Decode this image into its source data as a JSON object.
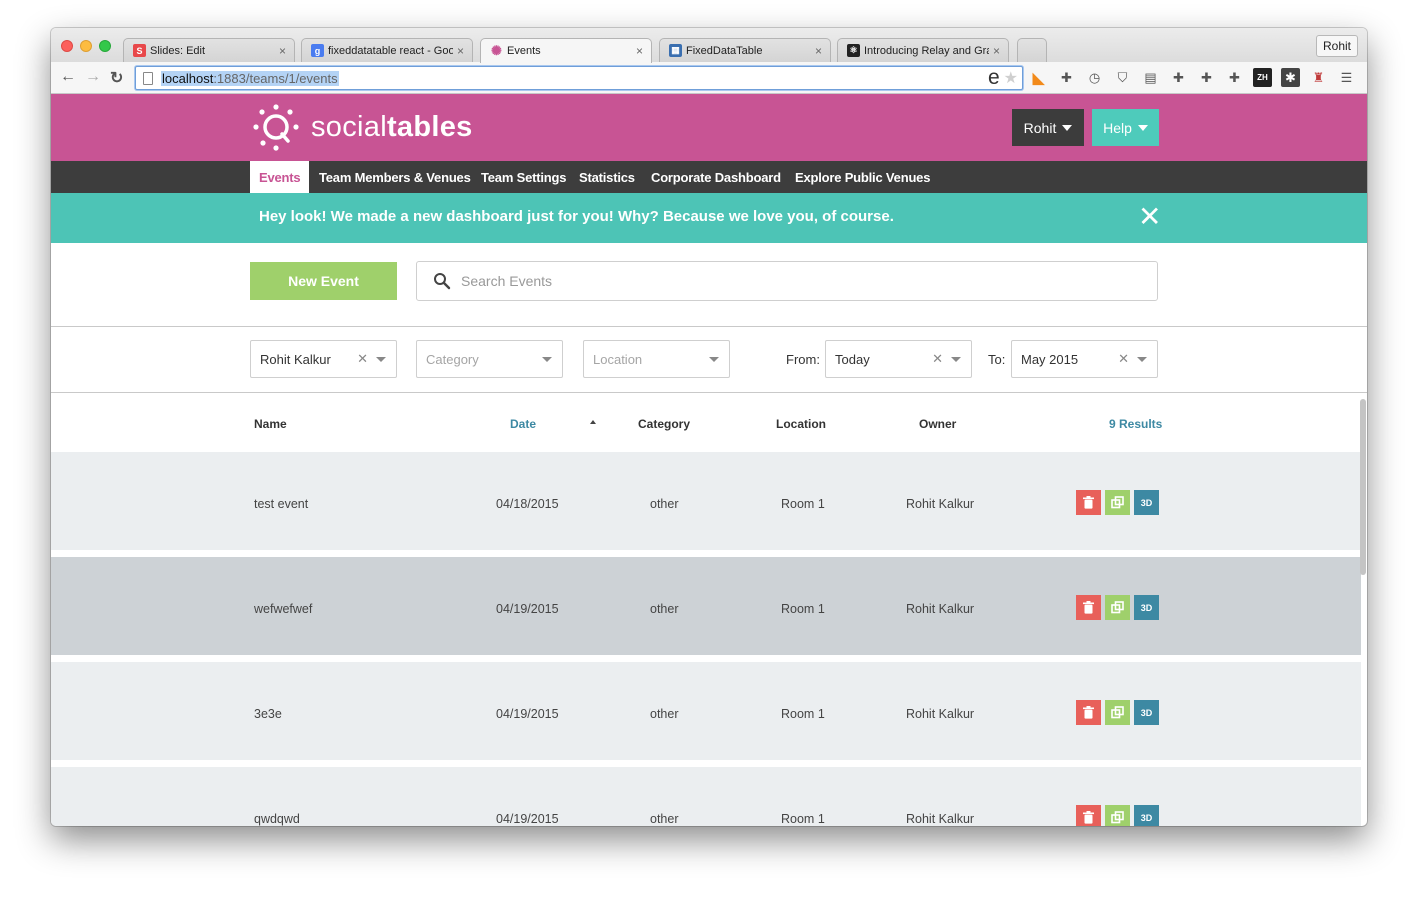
{
  "browser": {
    "tabs": [
      {
        "title": "Slides: Edit",
        "icon": "slides-icon",
        "color": "#e8484a",
        "glyph": "S"
      },
      {
        "title": "fixeddatatable react - Goo",
        "icon": "google-search-icon",
        "color": "#4a7cf0",
        "glyph": "g"
      },
      {
        "title": "Events",
        "icon": "socialtables-icon",
        "color": "#c85494",
        "glyph": "✺"
      },
      {
        "title": "FixedDataTable",
        "icon": "table-grid-icon",
        "color": "#3a6fb0",
        "glyph": "▦"
      },
      {
        "title": "Introducing Relay and Gra",
        "icon": "react-icon",
        "color": "#222222",
        "glyph": "⚛"
      }
    ],
    "active_tab_index": 2,
    "profile_name": "Rohit",
    "url_host": "localhost",
    "url_path": ":1883/teams/1/events",
    "extension_icons": [
      "rss-icon",
      "puzzle-icon",
      "clock-icon",
      "shield-icon",
      "book-icon",
      "puzzle-icon",
      "puzzle-icon",
      "puzzle-icon",
      "zh-icon",
      "asterisk-icon",
      "person-icon",
      "menu-icon"
    ],
    "zh_label": "ZH"
  },
  "header": {
    "brand_light": "social",
    "brand_bold": "tables",
    "user_label": "Rohit",
    "help_label": "Help"
  },
  "nav": {
    "items": [
      {
        "label": "Events",
        "active": true
      },
      {
        "label": "Team Members & Venues"
      },
      {
        "label": "Team Settings"
      },
      {
        "label": "Statistics"
      },
      {
        "label": "Corporate Dashboard"
      },
      {
        "label": "Explore Public Venues"
      }
    ]
  },
  "banner": {
    "text": "Hey look! We made a new dashboard just for you! Why? Because we love you, of course.",
    "close": "✕"
  },
  "actions": {
    "new_event_label": "New Event",
    "search_placeholder": "Search Events"
  },
  "filters": {
    "owner_value": "Rohit Kalkur",
    "category_placeholder": "Category",
    "location_placeholder": "Location",
    "from_label": "From:",
    "from_value": "Today",
    "to_label": "To:",
    "to_value": "May 2015"
  },
  "table": {
    "columns": {
      "name": "Name",
      "date": "Date",
      "category": "Category",
      "location": "Location",
      "owner": "Owner"
    },
    "sort_column": "date",
    "sort_direction": "ascending",
    "results_label": "9 Results",
    "row_action_3d_label": "3D",
    "rows": [
      {
        "name": "test event",
        "date": "04/18/2015",
        "category": "other",
        "location": "Room 1",
        "owner": "Rohit Kalkur"
      },
      {
        "name": "wefwefwef",
        "date": "04/19/2015",
        "category": "other",
        "location": "Room 1",
        "owner": "Rohit Kalkur"
      },
      {
        "name": "3e3e",
        "date": "04/19/2015",
        "category": "other",
        "location": "Room 1",
        "owner": "Rohit Kalkur"
      },
      {
        "name": "qwdqwd",
        "date": "04/19/2015",
        "category": "other",
        "location": "Room 1",
        "owner": "Rohit Kalkur"
      }
    ]
  },
  "colors": {
    "brand_pink": "#c85494",
    "teal": "#4dc4b6",
    "nav_dark": "#3d3d3d",
    "green": "#9fd06b",
    "red": "#e8605a",
    "blue": "#3d89a3"
  }
}
